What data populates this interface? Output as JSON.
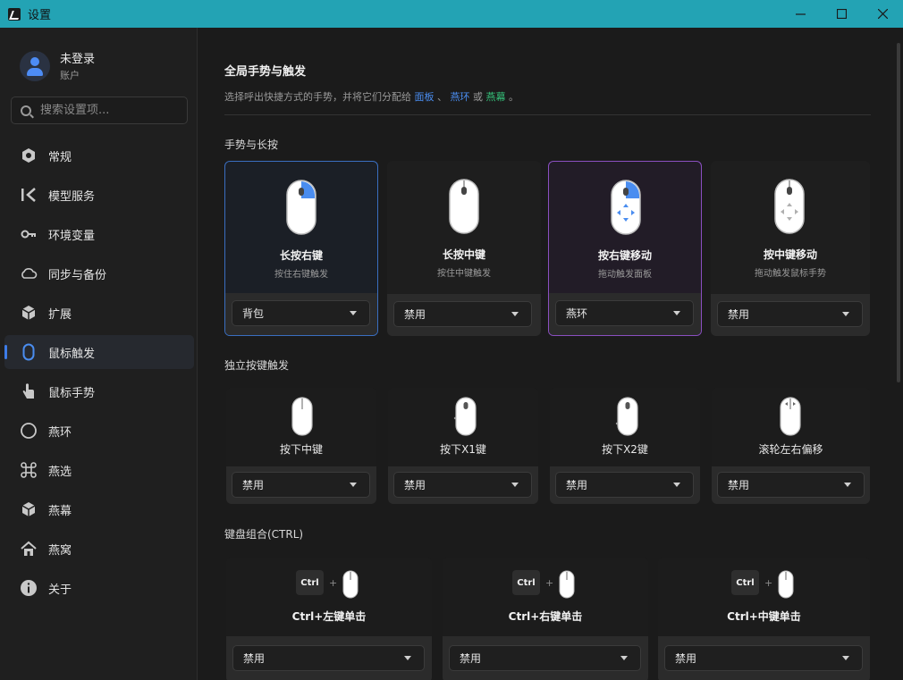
{
  "window": {
    "title": "设置",
    "controls": [
      "minimize",
      "maximize",
      "close"
    ]
  },
  "account": {
    "name": "未登录",
    "subtitle": "账户"
  },
  "search": {
    "placeholder": "搜索设置项..."
  },
  "nav": [
    {
      "label": "常规",
      "icon": "hexagon-icon"
    },
    {
      "label": "模型服务",
      "icon": "model-icon"
    },
    {
      "label": "环境变量",
      "icon": "key-icon"
    },
    {
      "label": "同步与备份",
      "icon": "cloud-icon"
    },
    {
      "label": "扩展",
      "icon": "cube-icon"
    },
    {
      "label": "鼠标触发",
      "icon": "mouse-icon",
      "active": true
    },
    {
      "label": "鼠标手势",
      "icon": "hand-pointer-icon"
    },
    {
      "label": "燕环",
      "icon": "circle-icon"
    },
    {
      "label": "燕选",
      "icon": "command-icon"
    },
    {
      "label": "燕幕",
      "icon": "box-icon"
    },
    {
      "label": "燕窝",
      "icon": "home-icon"
    },
    {
      "label": "关于",
      "icon": "info-icon"
    }
  ],
  "main": {
    "title": "全局手势与触发",
    "desc_prefix": "选择呼出快捷方式的手势，并将它们分配给 ",
    "link_panel": "面板",
    "sep1": " 、 ",
    "link_ring": "燕环",
    "sep2": " 或 ",
    "link_screen": "燕幕",
    "desc_suffix": " 。",
    "accent_blue": "#4a8df0",
    "accent_green": "#35c27a",
    "sections": {
      "gestures": {
        "title": "手势与长按",
        "cards": [
          {
            "title": "长按右键",
            "sub": "按住右键触发",
            "value": "背包",
            "selected": "blue"
          },
          {
            "title": "长按中键",
            "sub": "按住中键触发",
            "value": "禁用"
          },
          {
            "title": "按右键移动",
            "sub": "拖动触发面板",
            "value": "燕环",
            "selected": "purple"
          },
          {
            "title": "按中键移动",
            "sub": "拖动触发鼠标手势",
            "value": "禁用"
          }
        ]
      },
      "buttons": {
        "title": "独立按键触发",
        "cards": [
          {
            "label": "按下中键",
            "value": "禁用"
          },
          {
            "label": "按下X1键",
            "value": "禁用"
          },
          {
            "label": "按下X2键",
            "value": "禁用"
          },
          {
            "label": "滚轮左右偏移",
            "value": "禁用"
          }
        ]
      },
      "keyboard": {
        "title": "键盘组合(CTRL)",
        "key_label": "Ctrl",
        "plus": "+",
        "cards": [
          {
            "title": "Ctrl+左键单击",
            "value": "禁用"
          },
          {
            "title": "Ctrl+右键单击",
            "value": "禁用"
          },
          {
            "title": "Ctrl+中键单击",
            "value": "禁用"
          }
        ]
      }
    }
  }
}
